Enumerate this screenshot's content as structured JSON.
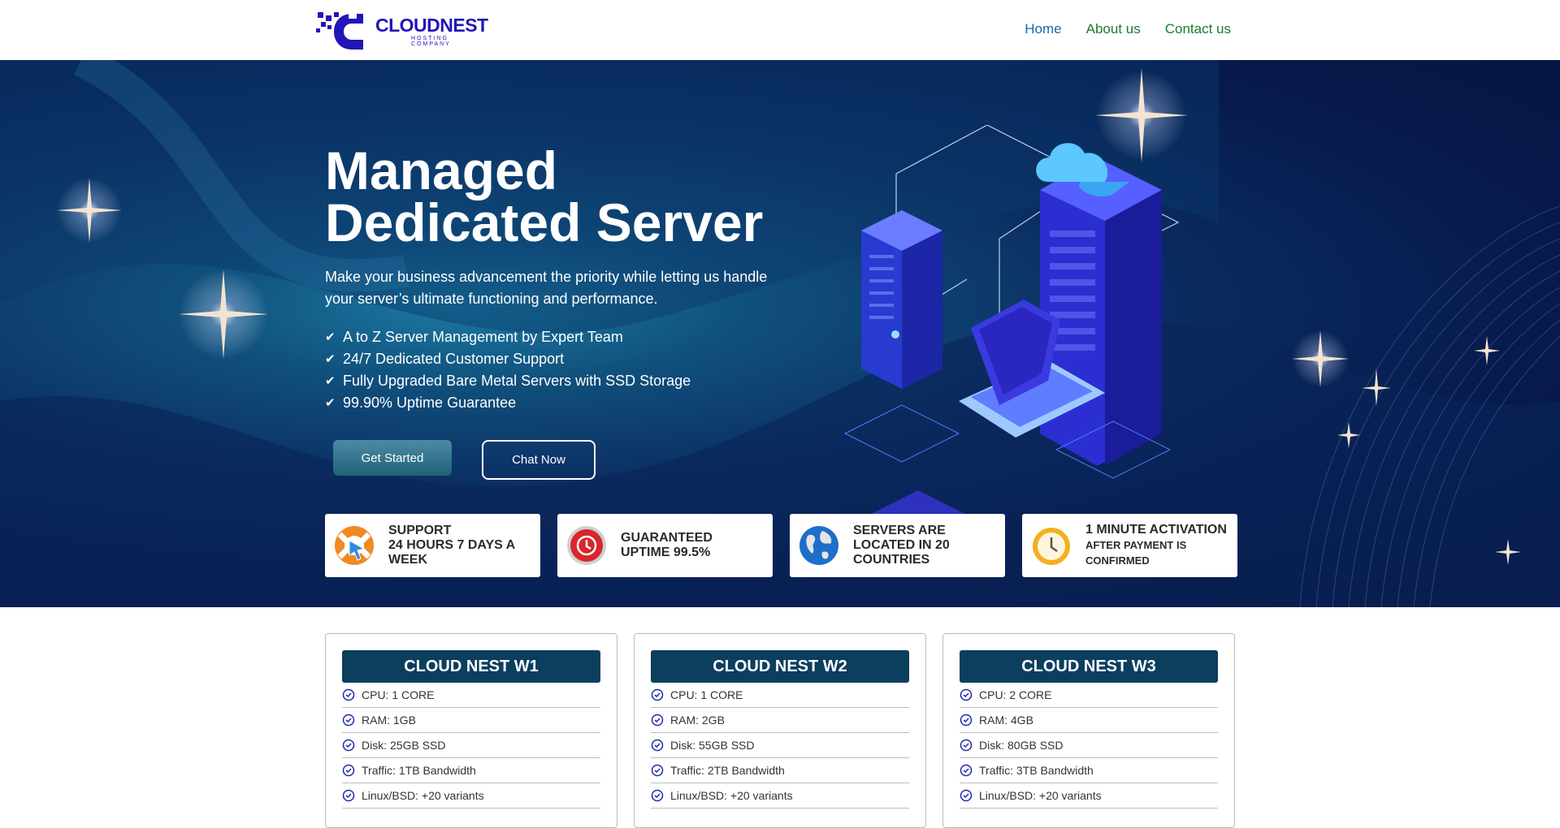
{
  "header": {
    "logo_name": "CLOUDNEST",
    "logo_tagline": "HOSTING COMPANY",
    "nav": [
      {
        "label": "Home",
        "active": true
      },
      {
        "label": "About us",
        "active": false
      },
      {
        "label": "Contact us",
        "active": false
      }
    ]
  },
  "hero": {
    "title_line1": "Managed",
    "title_line2": "Dedicated Server",
    "subtitle": "Make your business advancement the priority while letting us handle your server’s ultimate functioning and performance.",
    "features": [
      "A to Z Server Management by Expert Team",
      "24/7 Dedicated Customer Support",
      "Fully Upgraded Bare Metal Servers with SSD Storage",
      "99.90% Uptime Guarantee"
    ],
    "primary_button": "Get Started",
    "secondary_button": "Chat Now"
  },
  "cards": [
    {
      "icon": "support-lifebuoy-icon",
      "line1": "SUPPORT",
      "line2": "24 HOURS 7 DAYS A WEEK"
    },
    {
      "icon": "uptime-clock-icon",
      "line1": "GUARANTEED",
      "line2": "UPTIME 99.5%"
    },
    {
      "icon": "globe-icon",
      "line1": "SERVERS ARE LOCATED IN 20 COUNTRIES",
      "line2": ""
    },
    {
      "icon": "stopwatch-icon",
      "line1": "1 MINUTE ACTIVATION",
      "line2": "AFTER PAYMENT IS CONFIRMED"
    }
  ],
  "plans": [
    {
      "title": "CLOUD NEST W1",
      "specs": [
        "CPU: 1 CORE",
        "RAM: 1GB",
        "Disk: 25GB SSD",
        "Traffic: 1TB Bandwidth",
        "Linux/BSD: +20 variants"
      ]
    },
    {
      "title": "CLOUD NEST W2",
      "specs": [
        "CPU: 1 CORE",
        "RAM: 2GB",
        "Disk: 55GB SSD",
        "Traffic: 2TB Bandwidth",
        "Linux/BSD: +20 variants"
      ]
    },
    {
      "title": "CLOUD NEST W3",
      "specs": [
        "CPU: 2 CORE",
        "RAM: 4GB",
        "Disk: 80GB SSD",
        "Traffic: 3TB Bandwidth",
        "Linux/BSD: +20 variants"
      ]
    }
  ],
  "colors": {
    "brand": "#2116b8",
    "nav_active": "#176aa8",
    "nav_link": "#1f7a2c",
    "plan_header": "#0c3e5e"
  }
}
